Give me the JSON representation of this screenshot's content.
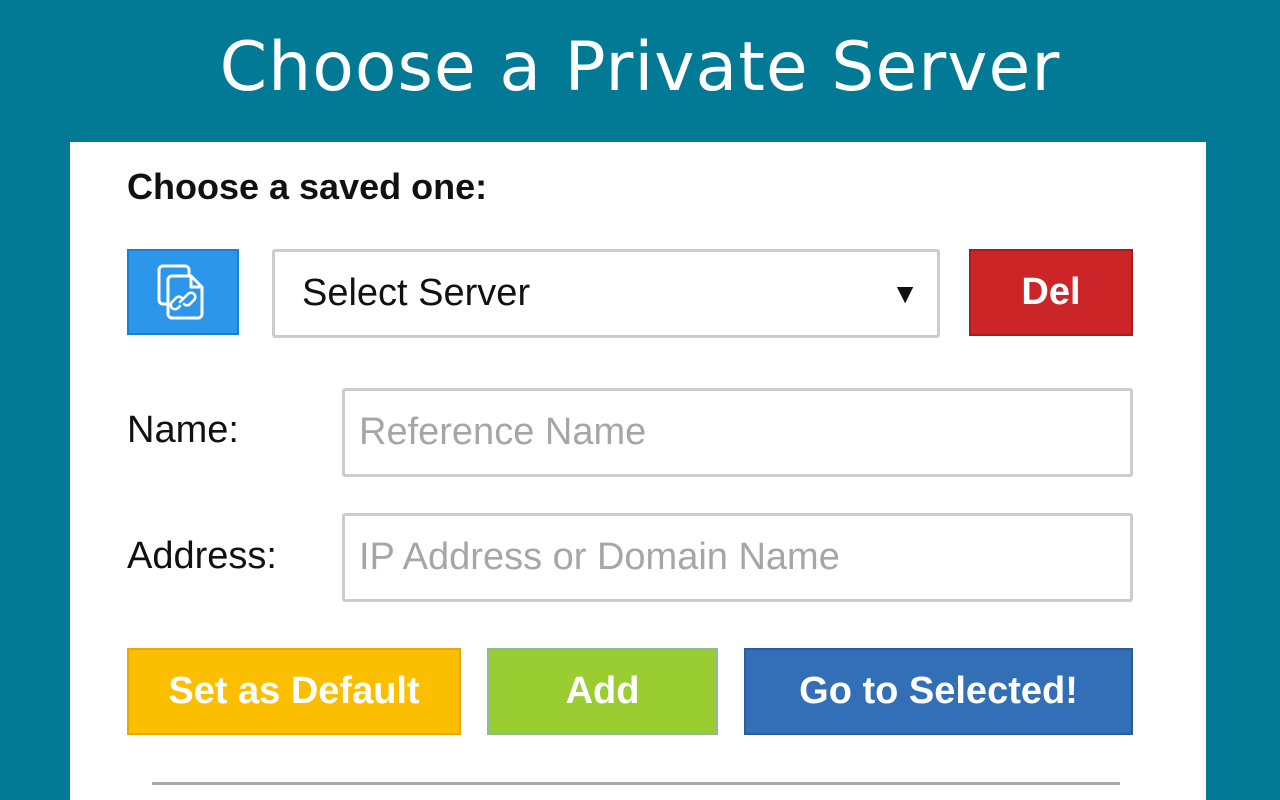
{
  "header": {
    "title": "Choose a Private Server"
  },
  "saved": {
    "heading": "Choose a saved one:",
    "copy_button_icon": "copy-link-icon",
    "select_value": "Select Server",
    "select_arrow": "▼",
    "delete_label": "Del"
  },
  "form": {
    "name_label": "Name:",
    "name_placeholder": "Reference Name",
    "name_value": "",
    "address_label": "Address:",
    "address_placeholder": "IP Address or Domain Name",
    "address_value": ""
  },
  "actions": {
    "set_default_label": "Set as Default",
    "add_label": "Add",
    "go_label": "Go to Selected!"
  },
  "colors": {
    "background": "#027a95",
    "copy_button": "#2b96ea",
    "delete_button": "#cc2528",
    "default_button": "#fbbf00",
    "add_button": "#9acd32",
    "go_button": "#336fb7"
  }
}
